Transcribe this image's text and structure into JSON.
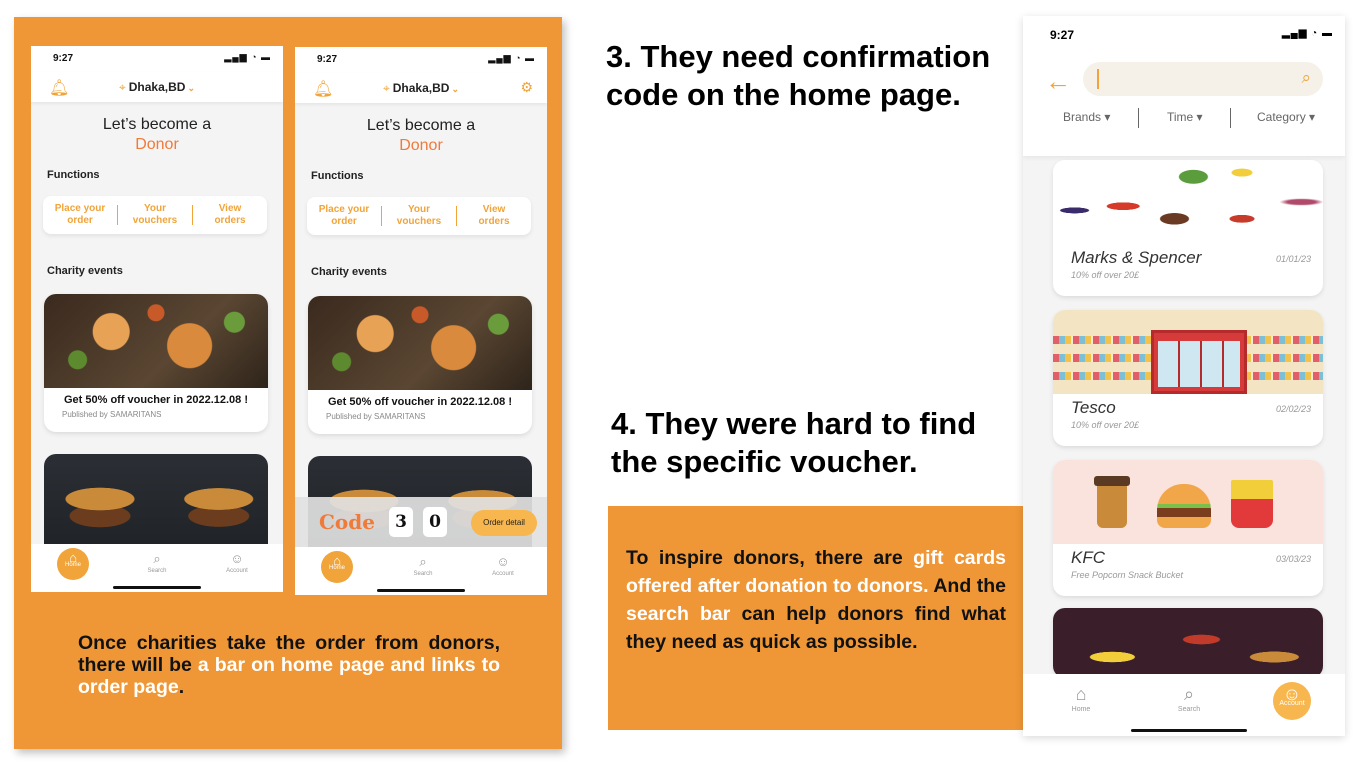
{
  "status": {
    "time_small": "9:27",
    "time_large": "9:27",
    "signal": "▂▄▆ ◔ ▬"
  },
  "app": {
    "location": "Dhaka,BD",
    "hero_line1": "Let’s become a",
    "hero_line2": "Donor",
    "functions_title": "Functions",
    "functions": [
      {
        "line1": "Place your",
        "line2": "order"
      },
      {
        "line1": "Your",
        "line2": "vouchers"
      },
      {
        "line1": "View",
        "line2": "orders"
      }
    ],
    "charity_title": "Charity events",
    "event": {
      "title": "Get 50% off voucher  in 2022.12.08 !",
      "publisher": "Published by SAMARITANS"
    },
    "tabs": {
      "home": "Home",
      "search": "Search",
      "account": "Account"
    },
    "codebar": {
      "label": "Code",
      "digits": [
        "3",
        "0"
      ],
      "button": "Order detail"
    }
  },
  "captions": {
    "left_part1": "Once charities take the order from donors, there will be ",
    "left_highlight": "a bar on home page and links to order page",
    "left_end": ".",
    "heading3": "3. They need confirmation code on the home page.",
    "heading4": "4. They were hard to find the specific voucher.",
    "box_part1": "To inspire donors, there are ",
    "box_hl1": "gift cards offered after donation to donors.",
    "box_part2": " And the ",
    "box_hl2": "search bar",
    "box_part3": " can help donors find what they need as quick as possible."
  },
  "search_screen": {
    "search_value": "",
    "filters": [
      "Brands ▾",
      "Time ▾",
      "Category ▾"
    ],
    "vouchers": [
      {
        "name": "Marks & Spencer",
        "offer": "10% off over 20£",
        "date": "01/01/23"
      },
      {
        "name": "Tesco",
        "offer": "10% off over 20£",
        "date": "02/02/23"
      },
      {
        "name": "KFC",
        "offer": "Free Popcorn Snack Bucket",
        "date": "03/03/23"
      }
    ],
    "tabs": {
      "home": "Home",
      "search": "Search",
      "account": "Account"
    }
  },
  "colors": {
    "accent": "#ef9736",
    "donor": "#f07a3a",
    "link": "#f0a43a"
  },
  "icons": {
    "bell": "bell-icon",
    "pin": "location-pin-icon",
    "gear": "gear-icon",
    "home": "home-icon",
    "search": "search-icon",
    "account": "account-icon",
    "back": "back-arrow-icon"
  }
}
